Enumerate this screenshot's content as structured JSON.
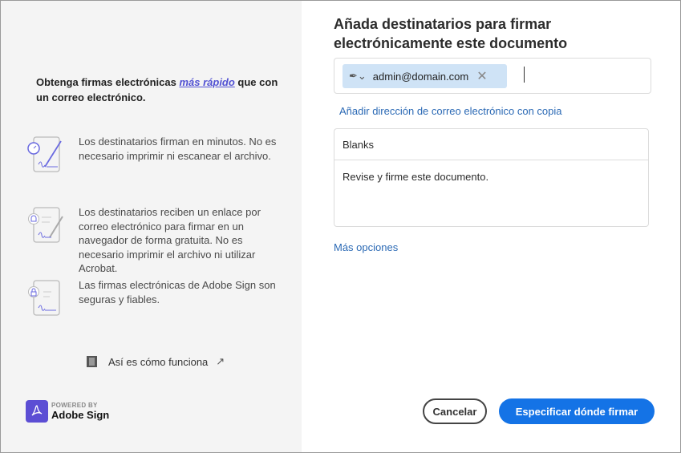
{
  "left": {
    "intro_before": "Obtenga firmas electrónicas ",
    "intro_link": "más rápido",
    "intro_after": " que con un correo electrónico.",
    "features": [
      {
        "icon": "stopwatch-document-icon",
        "text": "Los destinatarios firman en minutos. No es necesario imprimir ni escanear el archivo."
      },
      {
        "icon": "bell-document-icon",
        "text": "Los destinatarios reciben un enlace por correo electrónico para firmar en un navegador de forma gratuita. No es necesario imprimir el archivo ni utilizar Acrobat."
      },
      {
        "icon": "lock-document-icon",
        "text": "Las firmas electrónicas de Adobe Sign son seguras y fiables."
      }
    ],
    "how_label": "Así es cómo funciona",
    "powered_by": "POWERED BY",
    "brand": "Adobe Sign"
  },
  "main": {
    "title": "Añada destinatarios para firmar electrónicamente este documento",
    "recipient": "admin@domain.com",
    "cc_link": "Añadir dirección de correo electrónico con copia",
    "subject": "Blanks",
    "message": "Revise y firme este documento.",
    "more_options": "Más opciones",
    "cancel": "Cancelar",
    "submit": "Especificar dónde firmar"
  },
  "colors": {
    "accent": "#1473e6",
    "chip": "#cfe3f6",
    "brand": "#5c4ed4"
  }
}
